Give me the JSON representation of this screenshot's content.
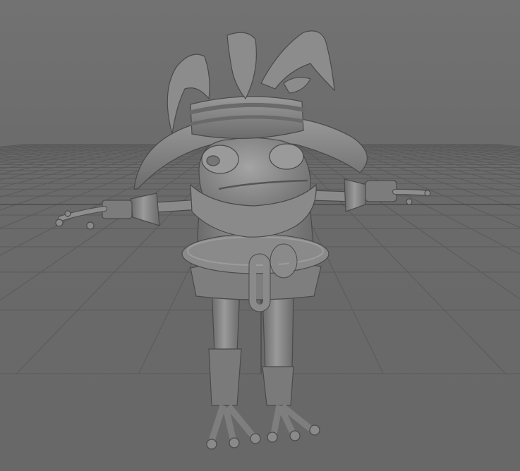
{
  "viewport": {
    "background_color": "#6e6e6e",
    "grid_color": "#5a5a5a",
    "grid_axis_color": "#3c3c3c",
    "model_fill": "#8c8c8c",
    "model_shadow": "#555555",
    "model_highlight": "#a8a8a8",
    "model_name": "frog-character-tpose"
  }
}
